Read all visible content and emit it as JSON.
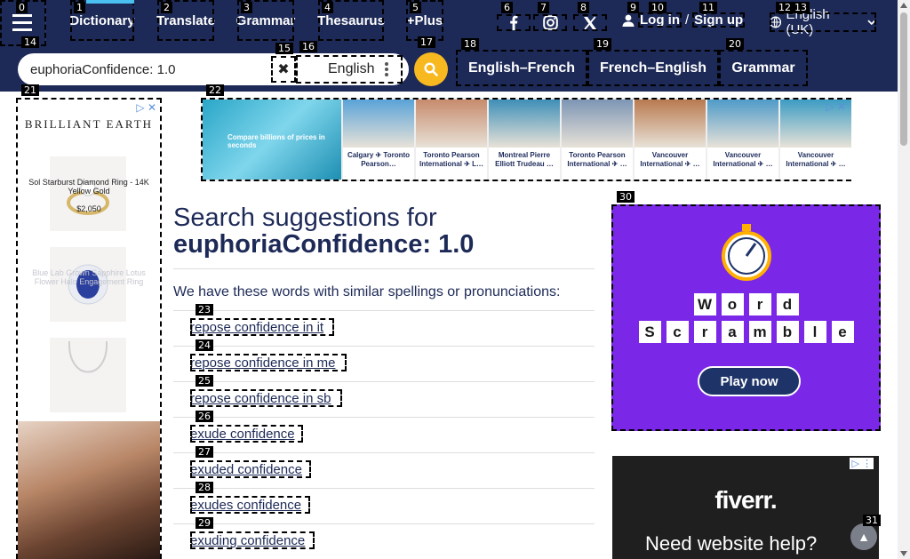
{
  "nav": {
    "dictionary": "Dictionary",
    "translate": "Translate",
    "grammar": "Grammar",
    "thesaurus": "Thesaurus",
    "plus": "+Plus",
    "login": "Log in",
    "slash": "/",
    "signup": "Sign up",
    "language": "English (UK)"
  },
  "search": {
    "value": "euphoriaConfidence: 1.0",
    "dictionary": "English",
    "quick_links": [
      "English–French",
      "French–English",
      "Grammar"
    ]
  },
  "left_ad": {
    "brand": "BRILLIANT EARTH",
    "item1_name": "Sol Starburst Diamond Ring - 14K Yellow Gold",
    "item1_price": "$2,050",
    "item2_name": "Blue Lab Grown Sapphire Lotus Flower Halo Engagement Ring"
  },
  "banner_ad": {
    "lead": "Compare billions of prices in seconds",
    "cards": [
      {
        "caption": "Calgary ✈ Toronto Pearson…",
        "color": "#5aa3d8"
      },
      {
        "caption": "Toronto Pearson International ✈ L…",
        "color": "#c78b6d"
      },
      {
        "caption": "Montreal Pierre Elliott Trudeau …",
        "color": "#3f8fb8"
      },
      {
        "caption": "Toronto Pearson International ✈ …",
        "color": "#7d96b5"
      },
      {
        "caption": "Vancouver International ✈ …",
        "color": "#b97a4f"
      },
      {
        "caption": "Vancouver International ✈ …",
        "color": "#4f9bc9"
      },
      {
        "caption": "Vancouver International ✈ …",
        "color": "#3c9cc4"
      }
    ]
  },
  "main": {
    "heading_prefix": "Search suggestions for",
    "heading_term": "euphoriaConfidence: 1.0",
    "intro": "We have these words with similar spellings or pronunciations:",
    "suggestions": [
      "repose confidence in it",
      "repose confidence in me",
      "repose confidence in sb",
      "exude confidence",
      "exuded confidence",
      "exudes confidence",
      "exuding confidence"
    ]
  },
  "game_ad": {
    "row1": [
      "W",
      "o",
      "r",
      "d"
    ],
    "row2": [
      "S",
      "c",
      "r",
      "a",
      "m",
      "b",
      "l",
      "e"
    ],
    "play": "Play now"
  },
  "fiverr_ad": {
    "logo": "fiverr.",
    "tagline": "Need website help?"
  },
  "markers": [
    "0",
    "1",
    "2",
    "3",
    "4",
    "5",
    "6",
    "7",
    "8",
    "9",
    "10",
    "11",
    "12",
    "13",
    "14",
    "15",
    "16",
    "17",
    "18",
    "19",
    "20",
    "21",
    "22",
    "23",
    "24",
    "25",
    "26",
    "27",
    "28",
    "29",
    "30",
    "31"
  ],
  "colors": {
    "nav_bg": "#1d2a57",
    "accent": "#f8b820",
    "game_bg": "#7b27e8"
  }
}
